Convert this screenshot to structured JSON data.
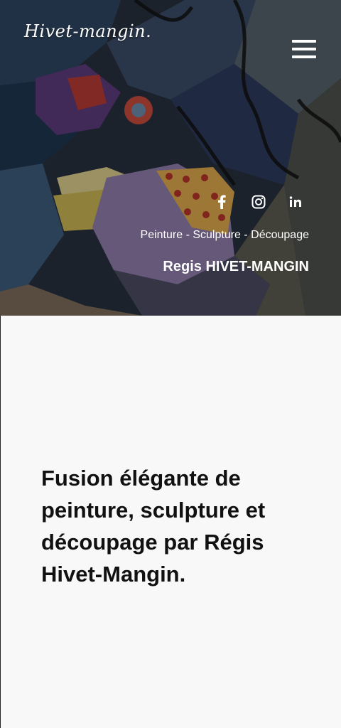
{
  "header": {
    "logo_text": "Hivet-mangin.",
    "menu_icon": "hamburger-menu-icon"
  },
  "social": [
    {
      "name": "facebook",
      "icon": "facebook-icon",
      "label": "f"
    },
    {
      "name": "instagram",
      "icon": "instagram-icon"
    },
    {
      "name": "linkedin",
      "icon": "linkedin-icon",
      "label": "in"
    }
  ],
  "hero": {
    "subtitle": "Peinture - Sculpture - Découpage",
    "artist_name": "Regis HIVET-MANGIN"
  },
  "main": {
    "tagline": "Fusion élégante de peinture, sculpture et découpage par Régis Hivet-Mangin."
  },
  "colors": {
    "background": "#f8f8f8",
    "text": "#111111",
    "hero_overlay_text": "#ffffff"
  }
}
